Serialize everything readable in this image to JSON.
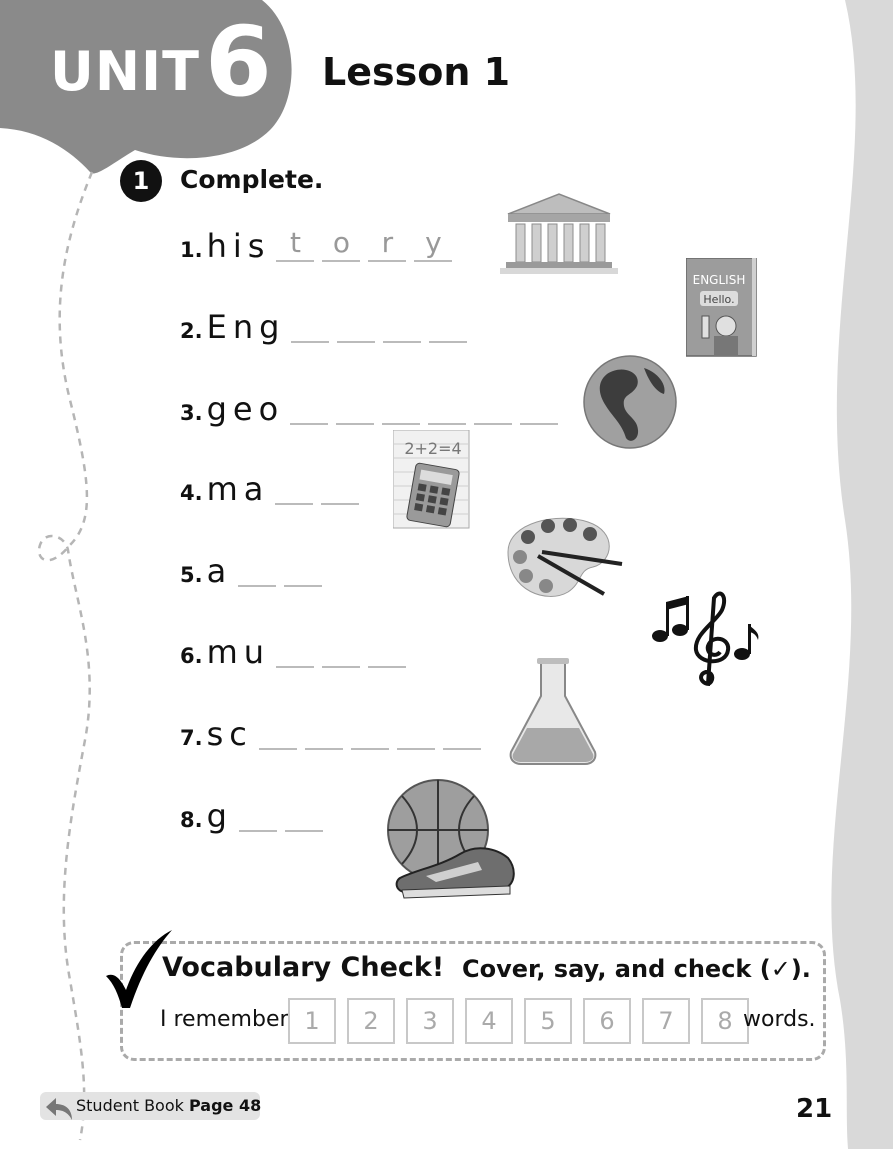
{
  "header": {
    "unit_word": "UNIT",
    "unit_number": "6",
    "lesson": "Lesson 1"
  },
  "exercise": {
    "number": "1",
    "title": "Complete."
  },
  "items": [
    {
      "num": "1.",
      "stem": "his",
      "blanks": [
        "t",
        "o",
        "r",
        "y"
      ],
      "picture": "building-icon"
    },
    {
      "num": "2.",
      "stem": "Eng",
      "blanks": [
        "",
        "",
        "",
        ""
      ],
      "picture": "english-book-icon"
    },
    {
      "num": "3.",
      "stem": "geo",
      "blanks": [
        "",
        "",
        "",
        "",
        "",
        ""
      ],
      "picture": "globe-icon"
    },
    {
      "num": "4.",
      "stem": "ma",
      "blanks": [
        "",
        ""
      ],
      "picture": "calculator-icon"
    },
    {
      "num": "5.",
      "stem": "a",
      "blanks": [
        "",
        ""
      ],
      "picture": "palette-icon"
    },
    {
      "num": "6.",
      "stem": "mu",
      "blanks": [
        "",
        "",
        ""
      ],
      "picture": "music-notes-icon"
    },
    {
      "num": "7.",
      "stem": "sc",
      "blanks": [
        "",
        "",
        "",
        "",
        ""
      ],
      "picture": "flask-icon"
    },
    {
      "num": "8.",
      "stem": "g",
      "blanks": [
        "",
        ""
      ],
      "picture": "basketball-shoe-icon"
    }
  ],
  "pictures": {
    "book_title": "ENGLISH",
    "book_greeting": "Hello.",
    "math_equation": "2+2=4"
  },
  "vocab_check": {
    "title": "Vocabulary Check!",
    "subtitle": "Cover, say, and check (✓).",
    "remember_label": "I remember",
    "numbers": [
      "1",
      "2",
      "3",
      "4",
      "5",
      "6",
      "7",
      "8"
    ],
    "words_label": "words."
  },
  "footer": {
    "student_book": "Student Book",
    "page_label": "Page 48",
    "page_number": "21"
  }
}
